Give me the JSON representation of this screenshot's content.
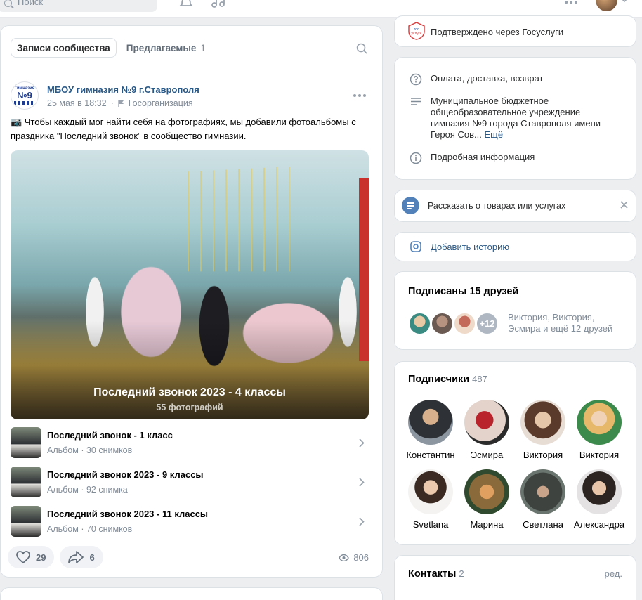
{
  "topbar": {
    "search_placeholder": "Поиск"
  },
  "feed": {
    "tabs": [
      {
        "label": "Записи сообщества",
        "active": true
      },
      {
        "label": "Предлагаемые",
        "count": "1",
        "active": false
      }
    ],
    "post": {
      "author": "МБОУ гимназия №9 г.Ставрополя",
      "logo_text": [
        "Гимназия",
        "№9"
      ],
      "date": "25 мая в 18:32",
      "separator": "·",
      "org_type": "Госорганизация",
      "text": "📷 Чтобы каждый мог найти себя на фотографиях, мы добавили фотоальбомы с праздника \"Последний звонок\" в сообщество гимназии.",
      "main_album": {
        "title": "Последний звонок 2023 - 4 классы",
        "count": "55 фотографий"
      },
      "albums": [
        {
          "title": "Последний звонок - 1 класс",
          "subtitle": "Альбом · 30 снимков"
        },
        {
          "title": "Последний звонок 2023 - 9 классы",
          "subtitle": "Альбом · 92 снимка"
        },
        {
          "title": "Последний звонок 2023 - 11 классы",
          "subtitle": "Альбом · 70 снимков"
        }
      ],
      "likes": "29",
      "shares": "6",
      "views": "806"
    }
  },
  "sidebar": {
    "gosuslugi": {
      "text": "Подтверждено через Госуслуги",
      "icon_text": [
        "гос",
        "услуги"
      ]
    },
    "info": {
      "payment": "Оплата, доставка, возврат",
      "description": "Муниципальное бюджетное общеобразовательное учреждение гимназия №9 города Ставрополя имени Героя Сов...",
      "more": "Ещё",
      "details": "Подробная информация"
    },
    "tell": {
      "text": "Рассказать о товарах или услугах"
    },
    "story": {
      "text": "Добавить историю"
    },
    "friends": {
      "title": "Подписаны 15 друзей",
      "more_badge": "+12",
      "names": "Виктория, Виктория, Эсмира и ещё 12 друзей"
    },
    "subscribers": {
      "title": "Подписчики",
      "count": "487",
      "people": [
        {
          "name": "Константин",
          "color": "#3b3f45"
        },
        {
          "name": "Эсмира",
          "color": "#c9b7ae"
        },
        {
          "name": "Виктория",
          "color": "#d9c3b5"
        },
        {
          "name": "Виктория",
          "color": "#6ba36a"
        },
        {
          "name": "Svetlana",
          "color": "#e9e4e2"
        },
        {
          "name": "Марина",
          "color": "#7a5a3a"
        },
        {
          "name": "Светлана",
          "color": "#4a4f4c"
        },
        {
          "name": "Александра",
          "color": "#d8d6d6"
        }
      ]
    },
    "contacts": {
      "title": "Контакты",
      "count": "2",
      "edit": "ред."
    }
  },
  "colors": {
    "link": "#2a5885",
    "accent": "#5181b8",
    "muted": "#818c99",
    "page_bg": "#edeef0"
  }
}
